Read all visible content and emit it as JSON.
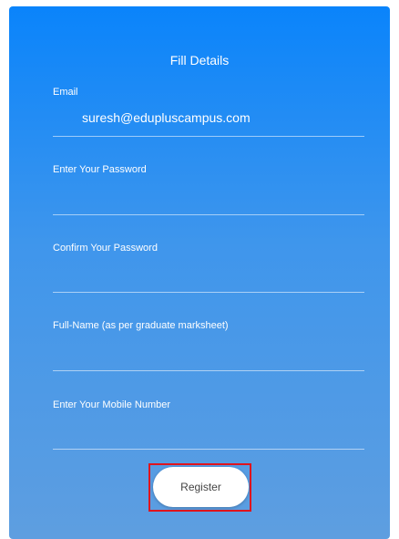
{
  "form": {
    "title": "Fill Details",
    "fields": [
      {
        "label": "Email",
        "value": "suresh@edupluscampus.com"
      },
      {
        "label": "Enter Your Password",
        "value": ""
      },
      {
        "label": "Confirm Your Password",
        "value": ""
      },
      {
        "label": "Full-Name (as per graduate marksheet)",
        "value": ""
      },
      {
        "label": "Enter Your Mobile Number",
        "value": ""
      }
    ],
    "register_label": "Register"
  },
  "colors": {
    "gradient_top": "#0a84fb",
    "gradient_bottom": "#5e9ee0",
    "highlight_border": "#e0141d"
  }
}
